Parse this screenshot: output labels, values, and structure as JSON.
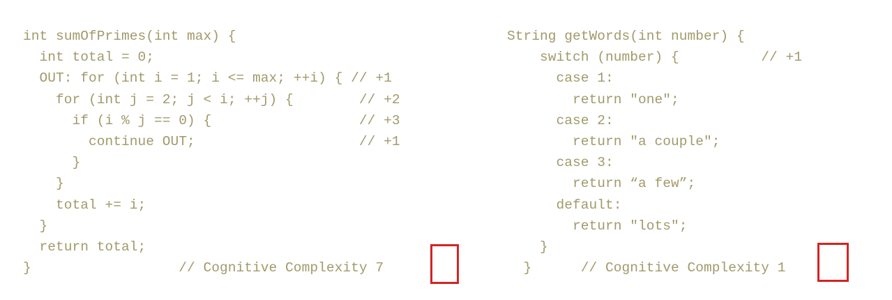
{
  "left_code": {
    "lines": [
      "int sumOfPrimes(int max) {",
      "  int total = 0;",
      "  OUT: for (int i = 1; i <= max; ++i) { // +1",
      "    for (int j = 2; j < i; ++j) {        // +2",
      "      if (i % j == 0) {                  // +3",
      "        continue OUT;                    // +1",
      "      }",
      "    }",
      "    total += i;",
      "  }",
      "  return total;",
      "}                  // Cognitive Complexity 7"
    ],
    "complexity_score": "7"
  },
  "right_code": {
    "lines": [
      "String getWords(int number) {",
      "    switch (number) {          // +1",
      "      case 1:",
      "        return \"one\";",
      "      case 2:",
      "        return \"a couple\";",
      "      case 3:",
      "        return “a few”;",
      "      default:",
      "        return \"lots\";",
      "    }",
      "  }      // Cognitive Complexity 1"
    ],
    "complexity_score": "1"
  },
  "colors": {
    "code_text": "#a19a6a",
    "highlight_border": "#d32424",
    "background": "#ffffff"
  }
}
